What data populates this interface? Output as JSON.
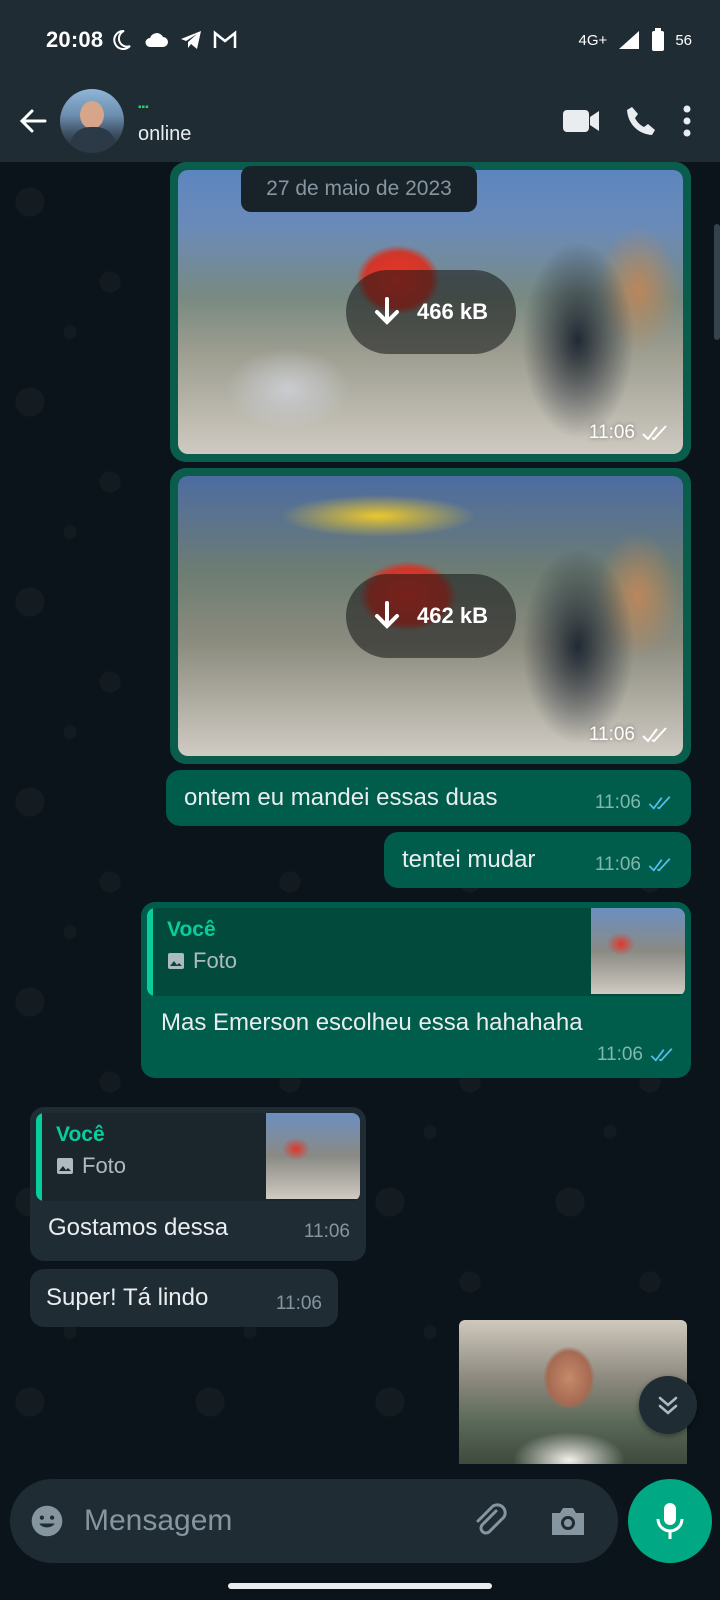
{
  "statusbar": {
    "time": "20:08",
    "network": "4G+",
    "battery": "56"
  },
  "header": {
    "contact_status": "online"
  },
  "chat": {
    "date_chip": "27 de maio de 2023",
    "image1": {
      "size": "466 kB",
      "time": "11:06"
    },
    "image2": {
      "size": "462 kB",
      "time": "11:06"
    },
    "msg1": {
      "text": "ontem eu mandei essas duas",
      "time": "11:06"
    },
    "msg2": {
      "text": "tentei mudar",
      "time": "11:06"
    },
    "reply_out": {
      "quote_name": "Você",
      "quote_type": "Foto",
      "text": "Mas Emerson escolheu essa hahahaha",
      "time": "11:06"
    },
    "reply_in": {
      "quote_name": "Você",
      "quote_type": "Foto",
      "text": "Gostamos dessa",
      "time": "11:06"
    },
    "msg_in2": {
      "text": "Super! Tá lindo",
      "time": "11:06"
    }
  },
  "composer": {
    "placeholder": "Mensagem"
  },
  "colors": {
    "accent": "#00a884",
    "outgoing": "#005c4b",
    "incoming": "#1f2c34",
    "background": "#0b141a"
  }
}
